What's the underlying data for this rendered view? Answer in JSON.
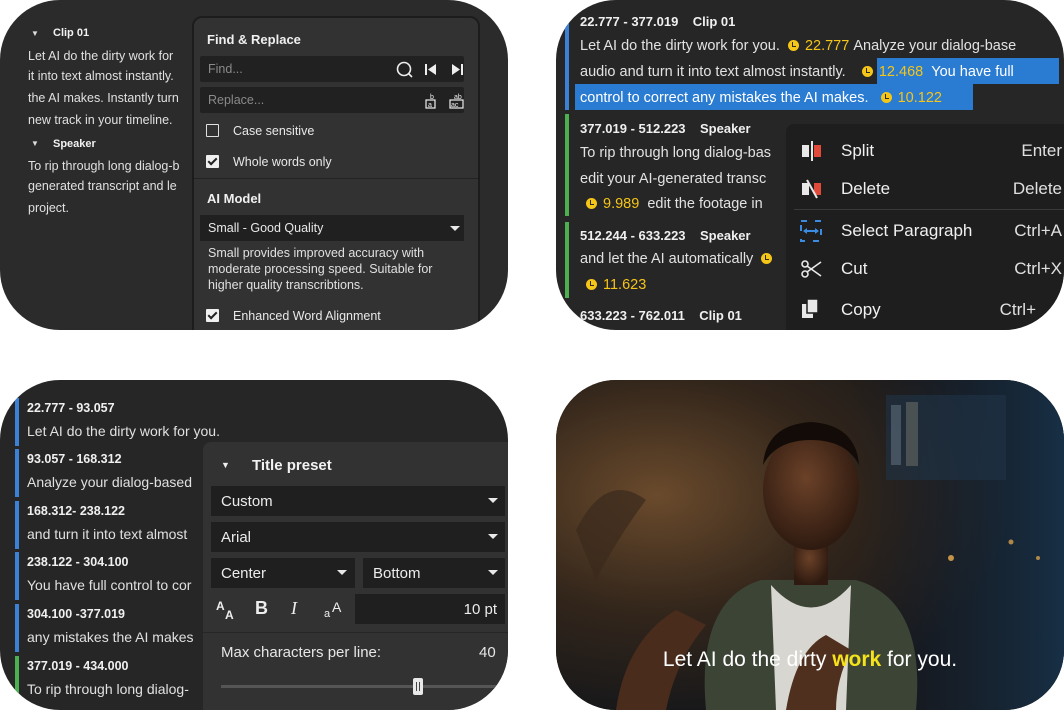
{
  "card_a": {
    "clip_header": "Clip 01",
    "clip_lines": [
      "Let AI do the dirty work for",
      "it into text almost instantly.",
      "the AI makes. Instantly turn",
      "new track in your timeline."
    ],
    "speaker_header": "Speaker",
    "speaker_lines": [
      "To rip through long dialog-b",
      "generated transcript and le",
      "project."
    ],
    "find_replace": {
      "title": "Find & Replace",
      "find_placeholder": "Find...",
      "replace_placeholder": "Replace...",
      "case_sensitive": "Case sensitive",
      "whole_words": "Whole words only"
    },
    "ai_model": {
      "title": "AI Model",
      "selected": "Small - Good Quality",
      "description": "Small provides improved accuracy with moderate processing speed. Suitable for higher quality transcribtions.",
      "enhanced": "Enhanced Word Alignment"
    }
  },
  "card_b": {
    "seg1": {
      "range": "22.777 - 377.019",
      "label": "Clip 01"
    },
    "line1a": "Let AI do the dirty work for you.",
    "t1": "22.777",
    "line1b": "Analyze your dialog-base",
    "line2a": "audio and turn it into text almost instantly.",
    "t2": "12.468",
    "line2b": "You have full",
    "line3a": "control to correct any mistakes the AI makes.",
    "t3": "10.122",
    "seg2": {
      "range": "377.019 - 512.223",
      "label": "Speaker"
    },
    "line4": "To rip through long dialog-bas",
    "line5": "edit your AI-generated transc",
    "t4": "9.989",
    "line6": "edit the footage in",
    "seg3": {
      "range": "512.244 - 633.223",
      "label": "Speaker"
    },
    "line7": "and let the AI automatically",
    "t5": "11.623",
    "seg4": {
      "range": "633.223 - 762.011",
      "label": "Clip 01"
    },
    "menu": [
      {
        "label": "Split",
        "key": "Enter"
      },
      {
        "label": "Delete",
        "key": "Delete"
      },
      {
        "label": "Select Paragraph",
        "key": "Ctrl+A"
      },
      {
        "label": "Cut",
        "key": "Ctrl+X"
      },
      {
        "label": "Copy",
        "key": "Ctrl+"
      }
    ]
  },
  "card_c": {
    "rows": [
      {
        "range": "22.777 - 93.057",
        "text": "Let AI do the dirty work for you."
      },
      {
        "range": "93.057 - 168.312",
        "text": "Analyze your dialog-based"
      },
      {
        "range": "168.312- 238.122",
        "text": "and turn it into text almost"
      },
      {
        "range": "238.122 - 304.100",
        "text": "You have full control to cor"
      },
      {
        "range": "304.100 -377.019",
        "text": "any mistakes the AI makes"
      },
      {
        "range": "377.019 - 434.000",
        "text": "To rip through long dialog-"
      }
    ],
    "title_preset": {
      "title": "Title preset",
      "preset": "Custom",
      "font": "Arial",
      "align": "Center",
      "position": "Bottom",
      "size": "10 pt",
      "max_chars_label": "Max characters per line:",
      "max_chars_value": "40",
      "slider_fraction": 0.7
    }
  },
  "card_d": {
    "caption_before": "Let AI do the dirty",
    "caption_word": "work",
    "caption_after": "for you."
  }
}
